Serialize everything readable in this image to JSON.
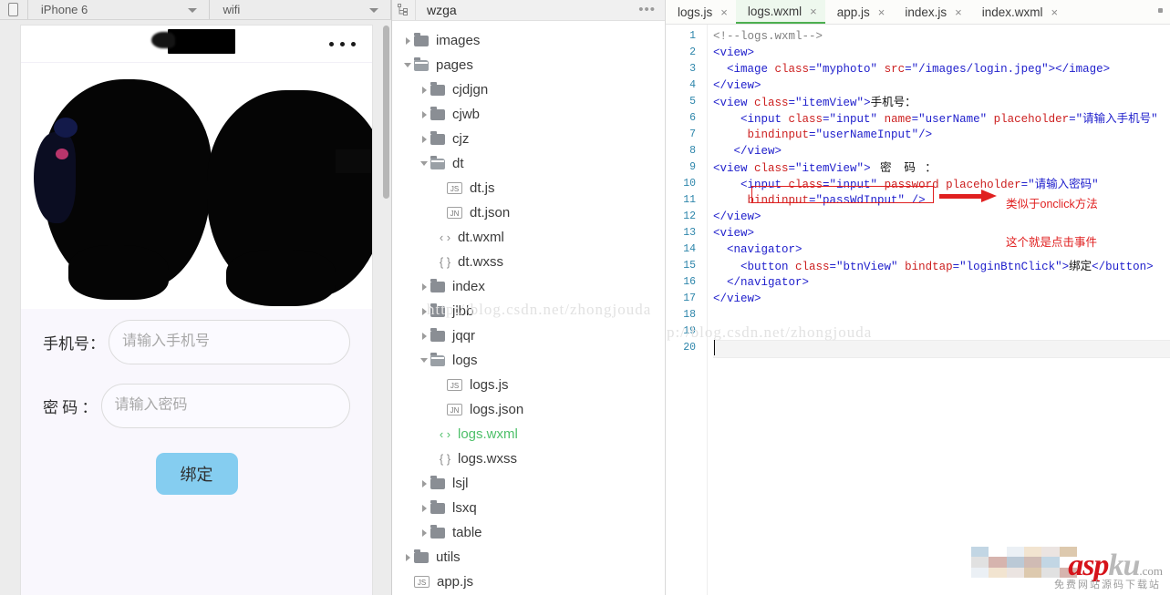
{
  "simulator": {
    "device_icon": "phone-icon",
    "device": "iPhone 6",
    "network": "wifi",
    "page": {
      "nav_more_icon": "ellipsis-icon",
      "phone_label": "手机号：",
      "phone_placeholder": "请输入手机号",
      "password_label": "密 码 ：",
      "password_placeholder": "请输入密码",
      "submit_label": "绑定"
    }
  },
  "filetree": {
    "header_icon": "project-tree-icon",
    "project": "wzga",
    "more_icon": "ellipsis-icon",
    "watermark": "http://blog.csdn.net/zhongjouda",
    "items": [
      {
        "label": "images",
        "type": "folder",
        "depth": 0,
        "state": "collapsed"
      },
      {
        "label": "pages",
        "type": "folder",
        "depth": 0,
        "state": "expanded"
      },
      {
        "label": "cjdjgn",
        "type": "folder",
        "depth": 1,
        "state": "collapsed"
      },
      {
        "label": "cjwb",
        "type": "folder",
        "depth": 1,
        "state": "collapsed"
      },
      {
        "label": "cjz",
        "type": "folder",
        "depth": 1,
        "state": "collapsed"
      },
      {
        "label": "dt",
        "type": "folder",
        "depth": 1,
        "state": "expanded"
      },
      {
        "label": "dt.js",
        "type": "js",
        "depth": 2,
        "state": "leaf"
      },
      {
        "label": "dt.json",
        "type": "jn",
        "depth": 2,
        "state": "leaf"
      },
      {
        "label": "dt.wxml",
        "type": "wxml",
        "depth": 2,
        "state": "leaf"
      },
      {
        "label": "dt.wxss",
        "type": "wxss",
        "depth": 2,
        "state": "leaf"
      },
      {
        "label": "index",
        "type": "folder",
        "depth": 1,
        "state": "collapsed"
      },
      {
        "label": "jlbb",
        "type": "folder",
        "depth": 1,
        "state": "collapsed"
      },
      {
        "label": "jqqr",
        "type": "folder",
        "depth": 1,
        "state": "collapsed"
      },
      {
        "label": "logs",
        "type": "folder",
        "depth": 1,
        "state": "expanded"
      },
      {
        "label": "logs.js",
        "type": "js",
        "depth": 2,
        "state": "leaf"
      },
      {
        "label": "logs.json",
        "type": "jn",
        "depth": 2,
        "state": "leaf"
      },
      {
        "label": "logs.wxml",
        "type": "wxml",
        "depth": 2,
        "state": "leaf",
        "active": true
      },
      {
        "label": "logs.wxss",
        "type": "wxss",
        "depth": 2,
        "state": "leaf"
      },
      {
        "label": "lsjl",
        "type": "folder",
        "depth": 1,
        "state": "collapsed"
      },
      {
        "label": "lsxq",
        "type": "folder",
        "depth": 1,
        "state": "collapsed"
      },
      {
        "label": "table",
        "type": "folder",
        "depth": 1,
        "state": "collapsed"
      },
      {
        "label": "utils",
        "type": "folder",
        "depth": 0,
        "state": "collapsed"
      },
      {
        "label": "app.js",
        "type": "js",
        "depth": 0,
        "state": "leaf"
      }
    ]
  },
  "editor": {
    "tabs": [
      {
        "label": "logs.js",
        "active": false,
        "close_icon": "close-icon"
      },
      {
        "label": "logs.wxml",
        "active": true,
        "close_icon": "close-icon"
      },
      {
        "label": "app.js",
        "active": false,
        "close_icon": "close-icon"
      },
      {
        "label": "index.js",
        "active": false,
        "close_icon": "close-icon"
      },
      {
        "label": "index.wxml",
        "active": false,
        "close_icon": "close-icon"
      }
    ],
    "line_numbers": [
      "1",
      "2",
      "3",
      "4",
      "5",
      "6",
      "7",
      "8",
      "9",
      "10",
      "11",
      "12",
      "13",
      "14",
      "15",
      "16",
      "17",
      "18",
      "19",
      "20"
    ],
    "code_lines": [
      "<!--logs.wxml-->",
      "<view>",
      "  <image class=\"myphoto\" src=\"/images/login.jpeg\"></image>",
      "</view>",
      "<view class=\"itemView\">手机号：",
      "    <input class=\"input\" name=\"userName\" placeholder=\"请输入手机号\"",
      "    bindinput=\"userNameInput\"/>",
      "  </view>",
      "<view class=\"itemView\">  密   码   ：",
      "    <input class=\"input\" password placeholder=\"请输入密码\"",
      "     bindinput=\"passWdInput\" />",
      "</view>",
      "<view>",
      "  <navigator>",
      "    <button class=\"btnView\" bindtap=\"loginBtnClick\">绑定</button>",
      "  </navigator>",
      "</view>",
      "",
      "",
      ""
    ],
    "annotations": [
      {
        "text": "类似于onclick方法",
        "color": "#e02020"
      },
      {
        "text": "这个就是点击事件",
        "color": "#e02020"
      }
    ],
    "watermark": "http://blog.csdn.net/zhongjouda"
  },
  "watermark_logo": {
    "brand_primary": "asp",
    "brand_secondary": "ku",
    "domain": ".com",
    "tagline": "免费网站源码下载站",
    "color_primary": "#d6131a",
    "color_secondary": "#b9b9b9"
  }
}
